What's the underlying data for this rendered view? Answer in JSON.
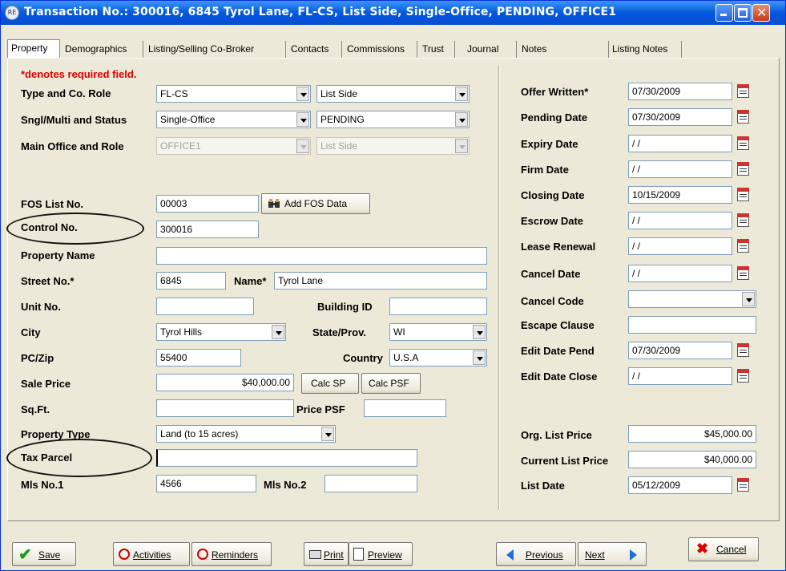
{
  "window": {
    "title": "Transaction No.: 300016, 6845 Tyrol Lane, FL-CS, List Side, Single-Office, PENDING, OFFICE1"
  },
  "tabs": [
    {
      "label": "Property"
    },
    {
      "label": "Demographics"
    },
    {
      "label": "Listing/Selling Co-Broker"
    },
    {
      "label": "Contacts"
    },
    {
      "label": "Commissions"
    },
    {
      "label": "Trust"
    },
    {
      "label": "Journal"
    },
    {
      "label": "Notes"
    },
    {
      "label": "Listing Notes"
    }
  ],
  "form": {
    "required_note": "*denotes required field.",
    "type_role": {
      "label": "Type and Co. Role",
      "type": "FL-CS",
      "role": "List Side"
    },
    "sngl_multi": {
      "label": "Sngl/Multi and Status",
      "value": "Single-Office",
      "status": "PENDING"
    },
    "main_office": {
      "label": "Main Office and Role",
      "office": "OFFICE1",
      "role": "List Side"
    },
    "fos_list": {
      "label": "FOS List No.",
      "value": "00003",
      "button": "Add FOS Data"
    },
    "control_no": {
      "label": "Control No.",
      "value": "300016"
    },
    "property_name": {
      "label": "Property Name",
      "value": ""
    },
    "street_no": {
      "label": "Street No.*",
      "value": "6845"
    },
    "street_name": {
      "label": "Name*",
      "value": "Tyrol Lane"
    },
    "unit_no": {
      "label": "Unit No.",
      "value": ""
    },
    "building_id": {
      "label": "Building ID",
      "value": ""
    },
    "city": {
      "label": "City",
      "value": "Tyrol Hills"
    },
    "state": {
      "label": "State/Prov.",
      "value": "WI"
    },
    "zip": {
      "label": "PC/Zip",
      "value": "55400"
    },
    "country": {
      "label": "Country",
      "value": "U.S.A"
    },
    "sale_price": {
      "label": "Sale Price",
      "value": "$40,000.00"
    },
    "calc_sp": "Calc SP",
    "calc_psf": "Calc PSF",
    "sqft": {
      "label": "Sq.Ft.",
      "value": ""
    },
    "price_psf": {
      "label": "Price PSF",
      "value": ""
    },
    "property_type": {
      "label": "Property Type",
      "value": "Land (to 15 acres)"
    },
    "tax_parcel": {
      "label": "Tax Parcel",
      "value": ""
    },
    "mls1": {
      "label": "Mls No.1",
      "value": "4566"
    },
    "mls2": {
      "label": "Mls No.2",
      "value": ""
    }
  },
  "dates": {
    "offer_written": {
      "label": "Offer Written*",
      "value": "07/30/2009"
    },
    "pending_date": {
      "label": "Pending Date",
      "value": "07/30/2009"
    },
    "expiry_date": {
      "label": "Expiry Date",
      "value": " / /"
    },
    "firm_date": {
      "label": "Firm Date",
      "value": " / /"
    },
    "closing_date": {
      "label": "Closing Date",
      "value": "10/15/2009"
    },
    "escrow_date": {
      "label": "Escrow Date",
      "value": " / /"
    },
    "lease_renewal": {
      "label": "Lease Renewal",
      "value": " / /"
    },
    "cancel_date": {
      "label": "Cancel Date",
      "value": " / /"
    },
    "cancel_code": {
      "label": "Cancel Code",
      "value": ""
    },
    "escape_clause": {
      "label": "Escape Clause",
      "value": ""
    },
    "edit_date_pend": {
      "label": "Edit Date Pend",
      "value": "07/30/2009"
    },
    "edit_date_close": {
      "label": "Edit Date Close",
      "value": " / /"
    },
    "org_list_price": {
      "label": "Org. List Price",
      "value": "$45,000.00"
    },
    "current_list_price": {
      "label": "Current List Price",
      "value": "$40,000.00"
    },
    "list_date": {
      "label": "List Date",
      "value": "05/12/2009"
    }
  },
  "buttons": {
    "save": "Save",
    "activities": "Activities",
    "reminders": "Reminders",
    "print": "Print",
    "preview": "Preview",
    "previous": "Previous",
    "next": "Next",
    "cancel": "Cancel"
  },
  "colors": {
    "required": "#e00000",
    "titlebar": "#0054e3",
    "window_bg": "#ece9d8"
  }
}
